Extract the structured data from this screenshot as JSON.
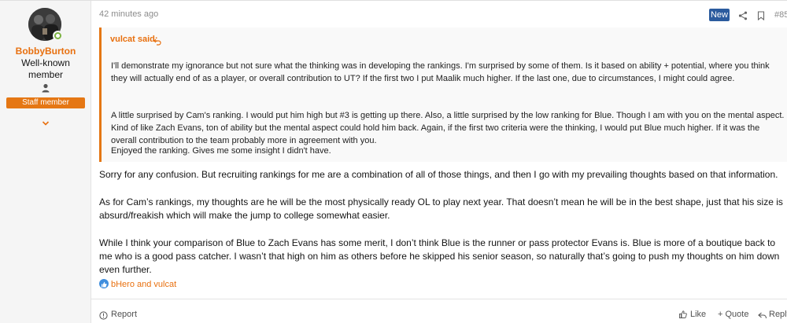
{
  "user": {
    "name": "BobbyBurton",
    "title": "Well-known member",
    "badge": "Staff member"
  },
  "header": {
    "time": "42 minutes ago",
    "new_badge": "New",
    "post_number": "#85"
  },
  "quote": {
    "author_label": "vulcat said:",
    "paragraphs": [
      "I'll demonstrate my ignorance but not sure what the thinking was in developing the rankings. I'm surprised by some of them. Is it based on ability + potential, where you think they will actually end of as a player, or overall contribution to UT? If the first two I put Maalik much higher. If the last one, due to circumstances, I might could agree.",
      "A little surprised by Cam's ranking. I would put him high but #3 is getting up there. Also, a little surprised by the low ranking for Blue. Though I am with you on the mental aspect. Kind of like Zach Evans, ton of ability but the mental aspect could hold him back. Again, if the first two criteria were the thinking, I would put Blue much higher. If it was the overall contribution to the team probably more in agreement with you.",
      "Enjoyed the ranking. Gives me some insight I didn't have."
    ]
  },
  "body": {
    "paragraphs": [
      "Sorry for any confusion. But recruiting rankings for me are a combination of all of those things, and then I go with my prevailing thoughts based on that information.",
      "As for Cam’s rankings, my thoughts are he will be the most physically ready OL to play next year. That doesn’t mean he will be in the best shape, just that his size is absurd/freakish which will make the jump to college somewhat easier.",
      "While I think your comparison of Blue to Zach Evans has some merit, I don’t think Blue is the runner or pass protector Evans is. Blue is more of a boutique back to me who is a good pass catcher. I wasn’t that high on him as others before he skipped his senior season, so naturally that’s going to push my thoughts on him down even further."
    ]
  },
  "reactions": {
    "icon": "like-reaction-icon",
    "text": "bHero and vulcat"
  },
  "footer": {
    "report": "Report",
    "like": "Like",
    "quote": "+ Quote",
    "reply": "Reply"
  },
  "colors": {
    "accent": "#e57714",
    "username": "#e8700f",
    "new_badge": "#2b5b9e",
    "online": "#7cb342",
    "reaction": "#3f8ede"
  }
}
